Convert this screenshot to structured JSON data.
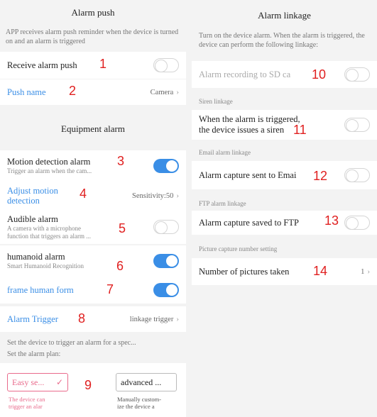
{
  "left": {
    "alarm_push": {
      "title": "Alarm push",
      "description": "APP receives alarm push reminder when the device is turned on and an alarm is triggered",
      "receive_label": "Receive alarm push",
      "receive_on": false,
      "push_name_label": "Push name",
      "push_name_value": "Camera"
    },
    "equipment_alarm": {
      "title": "Equipment alarm",
      "motion_label": "Motion detection alarm",
      "motion_sub": "Trigger an alarm when the cam...",
      "motion_on": true,
      "adjust_label_1": "Adjust motion",
      "adjust_label_2": "detection",
      "adjust_value": "Sensitivity:50",
      "audible_label": "Audible alarm",
      "audible_sub_1": "A camera with a microphone",
      "audible_sub_2": "function that triggers an alarm ...",
      "audible_on": false,
      "humanoid_label": "humanoid alarm",
      "humanoid_sub": "Smart Humanoid Recognition",
      "humanoid_on": true,
      "frame_label": "frame human form",
      "frame_on": true,
      "trigger_label": "Alarm Trigger",
      "trigger_value": "linkage trigger",
      "plan_desc_1": "Set the device to trigger an alarm for a spec...",
      "plan_desc_2": "Set the alarm plan:",
      "easy_label": "Easy se...",
      "easy_note_1": "The device can",
      "easy_note_2": "trigger an alar",
      "advanced_label": "advanced ...",
      "advanced_note_1": "Manually custom-",
      "advanced_note_2": "ize the device a"
    }
  },
  "right": {
    "title": "Alarm linkage",
    "description": "Turn on the device alarm. When the alarm is triggered, the device can perform the following linkage:",
    "sd_label": "Alarm recording to SD ca",
    "sd_on": false,
    "siren_header": "Siren linkage",
    "siren_label_1": "When the alarm is triggered,",
    "siren_label_2": "the device issues a siren",
    "siren_on": false,
    "email_header": "Email alarm linkage",
    "email_label": "Alarm capture sent to Emai",
    "email_on": false,
    "ftp_header": "FTP alarm linkage",
    "ftp_label": "Alarm capture saved to FTP",
    "ftp_on": false,
    "pic_header": "Picture capture number setting",
    "pic_label": "Number of pictures taken",
    "pic_value": "1"
  },
  "markers": [
    "1",
    "2",
    "3",
    "4",
    "5",
    "6",
    "7",
    "8",
    "9",
    "10",
    "11",
    "12",
    "13",
    "14"
  ],
  "icons": {
    "chevron": "chevron-right-icon",
    "check": "check-icon"
  },
  "colors": {
    "accent": "#3a8ee6",
    "marker": "#e02020",
    "easy": "#e96b8c"
  }
}
